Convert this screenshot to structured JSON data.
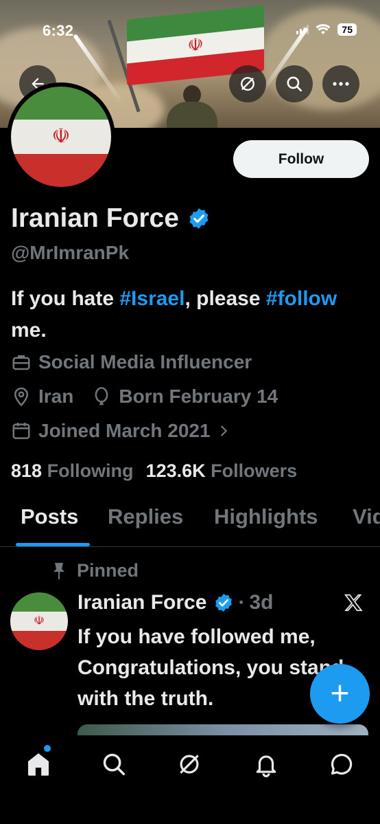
{
  "status_bar": {
    "time": "6:32",
    "battery": "75"
  },
  "header": {
    "back_icon": "arrow-left-icon",
    "grok_icon": "slash-circle-icon",
    "search_icon": "search-icon",
    "more_icon": "more-horizontal-icon"
  },
  "profile": {
    "display_name": "Iranian Force",
    "handle": "@MrImranPk",
    "follow_label": "Follow",
    "bio_part1": "If you hate ",
    "bio_tag1": "#Israel",
    "bio_part2": ", please ",
    "bio_tag2": "#follow",
    "bio_part3": " me.",
    "category": "Social Media Influencer",
    "location": "Iran",
    "birthday": "Born February 14",
    "joined": "Joined March 2021",
    "following_count": "818",
    "following_label": "Following",
    "followers_count": "123.6K",
    "followers_label": "Followers"
  },
  "tabs": [
    {
      "label": "Posts",
      "active": true
    },
    {
      "label": "Replies",
      "active": false
    },
    {
      "label": "Highlights",
      "active": false
    },
    {
      "label": "Vid",
      "active": false
    }
  ],
  "pinned_post": {
    "pinned_label": "Pinned",
    "author": "Iranian Force",
    "time": "3d",
    "separator": "·",
    "text": "If you have followed me, Congratulations, you stand with the truth."
  },
  "fab_label": "+",
  "colors": {
    "accent": "#1d9bf0",
    "background": "#000000",
    "secondary_text": "#71767b"
  },
  "bottom_nav": [
    "home-icon",
    "search-icon",
    "grok-icon",
    "notifications-bell-icon",
    "messages-icon"
  ]
}
